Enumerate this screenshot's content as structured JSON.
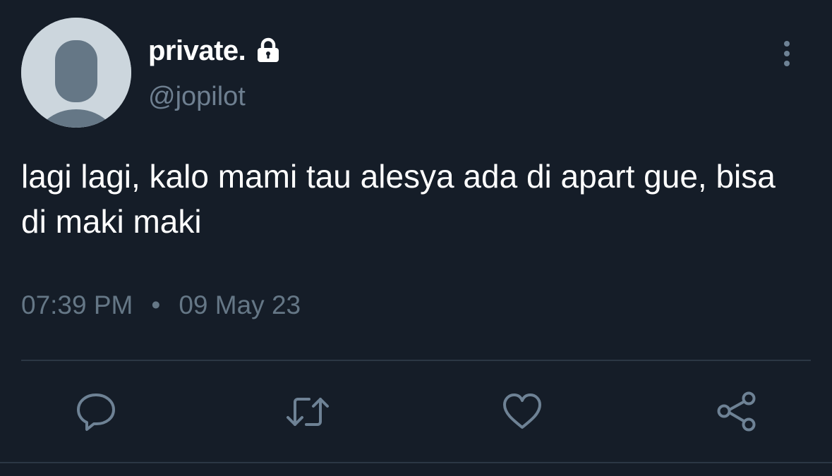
{
  "tweet": {
    "display_name": "private.",
    "handle": "@jopilot",
    "text": "lagi lagi, kalo mami tau alesya ada di apart gue, bisa di maki maki",
    "time": "07:39 PM",
    "separator": "•",
    "date": "09 May 23"
  },
  "icons": {
    "avatar": "default-avatar",
    "protected": "lock-icon",
    "more": "vertical-dots-icon",
    "reply": "speech-bubble-icon",
    "retweet": "retweet-icon",
    "like": "heart-icon",
    "share": "share-icon"
  },
  "colors": {
    "background": "#151d28",
    "text_primary": "#ffffff",
    "text_secondary": "#657786",
    "icon": "#6e8295",
    "divider": "#2b3744",
    "avatar_bg": "#ccd6dd",
    "avatar_fg": "#657786"
  }
}
